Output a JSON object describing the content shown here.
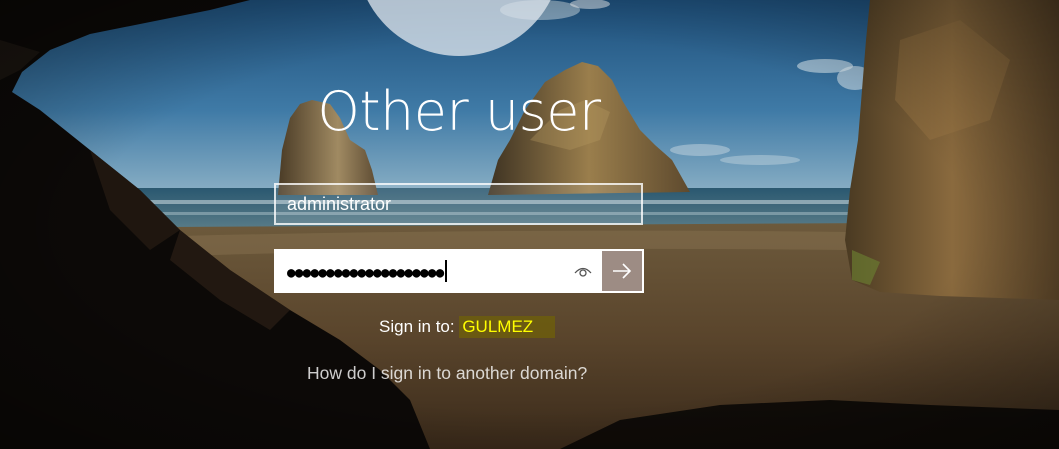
{
  "lock_screen": {
    "title": "Other user",
    "username_value": "administrator",
    "password_masked": "●●●●●●●●●●●●●●●●●●●●",
    "reveal_icon": "eye-icon",
    "submit_icon": "arrow-right-icon",
    "sign_in_label": "Sign in to: ",
    "domain_name": "GULMEZ",
    "help_link": "How do I sign in to another domain?"
  },
  "colors": {
    "domain_text": "#ffff00",
    "domain_highlight": "#6e5f0a",
    "submit_bg": "#8c786e"
  }
}
